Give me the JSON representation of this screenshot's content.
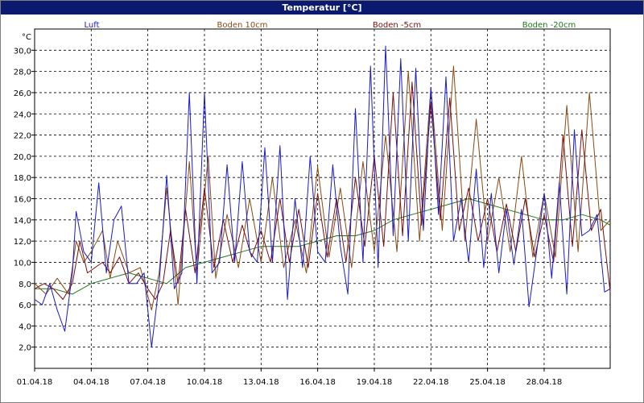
{
  "window": {
    "title": "Temperatur [°C]"
  },
  "colors": {
    "title_bar": "#0b1a6e",
    "Luft": "#1a1acc",
    "Boden 10cm": "#8a4a12",
    "Boden -5cm": "#7a0e0e",
    "Boden -20cm": "#1a7a1a",
    "grid": "#000000"
  },
  "chart_data": {
    "type": "line",
    "title": "Temperatur [°C]",
    "ylabel": "°C",
    "xlabel": "",
    "ylim": [
      0,
      32
    ],
    "y_ticks": [
      "2,0",
      "4,0",
      "6,0",
      "8,0",
      "10,0",
      "12,0",
      "14,0",
      "16,0",
      "18,0",
      "20,0",
      "22,0",
      "24,0",
      "26,0",
      "28,0",
      "30,0"
    ],
    "x_ticks": [
      "01.04.18",
      "04.04.18",
      "07.04.18",
      "10.04.18",
      "13.04.18",
      "16.04.18",
      "19.04.18",
      "22.04.18",
      "25.04.18",
      "28.04.18"
    ],
    "x_range_days": [
      0,
      30.5
    ],
    "grid": true,
    "legend_position": "top",
    "series": [
      {
        "name": "Luft",
        "x": [
          0,
          0.4,
          0.8,
          1.2,
          1.6,
          2.0,
          2.2,
          2.6,
          3.0,
          3.4,
          3.8,
          4.2,
          4.6,
          5.0,
          5.4,
          5.8,
          6.2,
          6.6,
          7.0,
          7.4,
          7.8,
          8.2,
          8.6,
          9.0,
          9.4,
          9.8,
          10.2,
          10.6,
          11.0,
          11.4,
          11.8,
          12.2,
          12.6,
          13.0,
          13.4,
          13.8,
          14.2,
          14.6,
          15.0,
          15.4,
          15.8,
          16.2,
          16.6,
          17.0,
          17.4,
          17.8,
          18.2,
          18.6,
          19.0,
          19.4,
          19.8,
          20.2,
          20.6,
          21.0,
          21.4,
          21.8,
          22.2,
          22.6,
          23.0,
          23.4,
          23.8,
          24.2,
          24.6,
          25.0,
          25.4,
          25.8,
          26.2,
          26.6,
          27.0,
          27.4,
          27.8,
          28.2,
          28.6,
          29.0,
          29.4,
          29.8,
          30.2,
          30.5
        ],
        "values": [
          6.5,
          6.0,
          8.0,
          5.5,
          3.5,
          9.0,
          14.8,
          11.0,
          10.0,
          17.5,
          9.0,
          14.0,
          15.3,
          8.0,
          8.0,
          9.0,
          2.0,
          8.0,
          18.2,
          7.5,
          9.0,
          26.0,
          8.0,
          26.0,
          9.0,
          10.0,
          19.2,
          10.0,
          19.5,
          11.0,
          10.0,
          20.8,
          10.0,
          21.0,
          6.5,
          16.0,
          9.5,
          20.0,
          11.0,
          10.0,
          19.2,
          11.5,
          7.0,
          24.5,
          10.0,
          28.5,
          9.5,
          30.4,
          12.5,
          29.2,
          12.0,
          28.3,
          13.0,
          26.5,
          14.5,
          27.5,
          12.0,
          16.0,
          10.0,
          18.8,
          9.5,
          16.5,
          9.0,
          15.0,
          9.8,
          15.0,
          5.8,
          11.0,
          16.5,
          8.5,
          17.5,
          7.0,
          22.5,
          12.5,
          13.0,
          14.5,
          7.2,
          7.5
        ]
      },
      {
        "name": "Boden 10cm",
        "x": [
          0,
          0.6,
          1.2,
          1.8,
          2.2,
          2.6,
          3.0,
          3.6,
          4.0,
          4.4,
          5.0,
          5.6,
          6.2,
          6.6,
          7.0,
          7.6,
          8.2,
          8.6,
          9.2,
          9.6,
          10.2,
          10.8,
          11.4,
          12.0,
          12.6,
          13.2,
          13.8,
          14.4,
          15.0,
          15.6,
          16.2,
          16.8,
          17.4,
          18.0,
          18.6,
          19.2,
          19.8,
          20.4,
          21.0,
          21.6,
          22.2,
          22.8,
          23.4,
          24.0,
          24.6,
          25.2,
          25.8,
          26.4,
          27.0,
          27.6,
          28.2,
          28.8,
          29.4,
          30.0,
          30.5
        ],
        "values": [
          8.0,
          7.0,
          8.5,
          7.0,
          12.0,
          10.0,
          11.0,
          13.0,
          8.5,
          12.0,
          9.0,
          9.5,
          5.5,
          9.0,
          17.0,
          6.0,
          19.5,
          9.0,
          20.0,
          8.5,
          14.5,
          9.5,
          16.0,
          10.0,
          18.0,
          9.5,
          14.0,
          9.0,
          19.0,
          10.5,
          17.0,
          9.5,
          19.5,
          11.0,
          22.0,
          11.0,
          28.0,
          12.0,
          26.5,
          13.0,
          28.5,
          12.0,
          23.5,
          12.0,
          18.0,
          11.0,
          20.0,
          10.5,
          16.5,
          10.5,
          24.8,
          11.0,
          26.0,
          13.0,
          14.0
        ]
      },
      {
        "name": "Boden -5cm",
        "x": [
          0,
          0.5,
          1.0,
          1.5,
          2.0,
          2.4,
          2.8,
          3.2,
          3.6,
          4.0,
          4.5,
          5.0,
          5.5,
          6.0,
          6.4,
          6.8,
          7.2,
          7.6,
          8.0,
          8.5,
          9.0,
          9.5,
          10.0,
          10.5,
          11.0,
          11.5,
          12.0,
          12.5,
          13.0,
          13.5,
          14.0,
          14.5,
          15.0,
          15.5,
          16.0,
          16.5,
          17.0,
          17.5,
          18.0,
          18.5,
          19.0,
          19.5,
          20.0,
          20.5,
          21.0,
          21.5,
          22.0,
          22.5,
          23.0,
          23.5,
          24.0,
          24.5,
          25.0,
          25.5,
          26.0,
          26.5,
          27.0,
          27.5,
          28.0,
          28.5,
          29.0,
          29.5,
          30.0,
          30.5
        ],
        "values": [
          7.5,
          8.0,
          7.5,
          6.5,
          8.0,
          12.0,
          9.0,
          9.5,
          10.0,
          9.0,
          10.5,
          8.0,
          9.0,
          7.5,
          6.5,
          8.0,
          13.0,
          8.0,
          15.0,
          9.0,
          17.0,
          9.5,
          14.0,
          10.0,
          13.5,
          10.5,
          13.0,
          10.0,
          16.0,
          10.0,
          15.0,
          9.5,
          16.5,
          10.5,
          16.0,
          10.0,
          18.0,
          11.5,
          20.0,
          11.5,
          26.0,
          12.5,
          27.0,
          13.5,
          25.0,
          14.0,
          25.5,
          13.0,
          17.0,
          12.0,
          16.0,
          11.0,
          15.5,
          11.0,
          16.0,
          10.5,
          14.5,
          10.0,
          22.0,
          11.5,
          22.5,
          13.0,
          15.0,
          7.2
        ]
      },
      {
        "name": "Boden -20cm",
        "x": [
          0,
          1.0,
          2.0,
          3.0,
          4.0,
          5.0,
          6.0,
          7.0,
          8.0,
          9.0,
          10.0,
          11.0,
          12.0,
          13.0,
          14.0,
          15.0,
          16.0,
          17.0,
          18.0,
          19.0,
          20.0,
          21.0,
          22.0,
          23.0,
          24.0,
          25.0,
          26.0,
          27.0,
          28.0,
          29.0,
          30.0,
          30.5
        ],
        "values": [
          7.5,
          7.5,
          7.0,
          8.0,
          8.5,
          9.0,
          8.5,
          8.0,
          9.5,
          10.0,
          10.5,
          11.0,
          11.5,
          11.5,
          11.5,
          12.0,
          12.5,
          12.5,
          13.0,
          14.0,
          14.5,
          15.0,
          15.5,
          16.0,
          15.5,
          15.0,
          14.5,
          14.0,
          14.0,
          14.5,
          14.0,
          13.5
        ]
      }
    ]
  }
}
